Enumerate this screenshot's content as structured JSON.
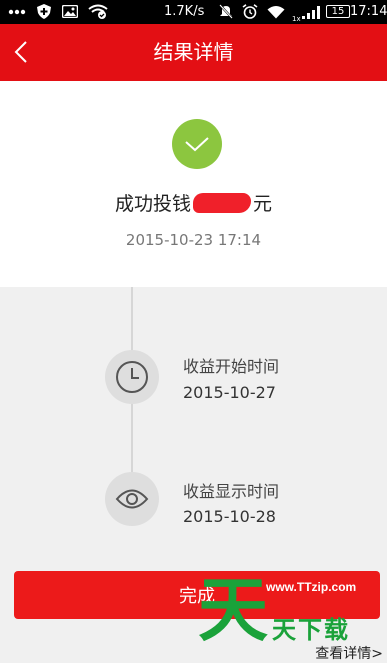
{
  "status_bar": {
    "speed": "1.7K/s",
    "network_small": "1x",
    "battery": "15",
    "time": "17:14"
  },
  "header": {
    "title": "结果详情"
  },
  "result": {
    "prefix": "成功投钱",
    "suffix": "元",
    "datetime": "2015-10-23 17:14",
    "status_color": "#8cc63f"
  },
  "timeline": [
    {
      "icon": "clock-icon",
      "label": "收益开始时间",
      "date": "2015-10-27"
    },
    {
      "icon": "eye-icon",
      "label": "收益显示时间",
      "date": "2015-10-28"
    }
  ],
  "actions": {
    "done_label": "完成",
    "details_link": "查看详情>"
  },
  "watermark": {
    "char": "天",
    "url": "www.TTzip.com",
    "name": "天下载"
  },
  "colors": {
    "brand_red": "#e30f14",
    "button_red": "#ec1a1a",
    "watermark_green": "#1aa23a"
  }
}
